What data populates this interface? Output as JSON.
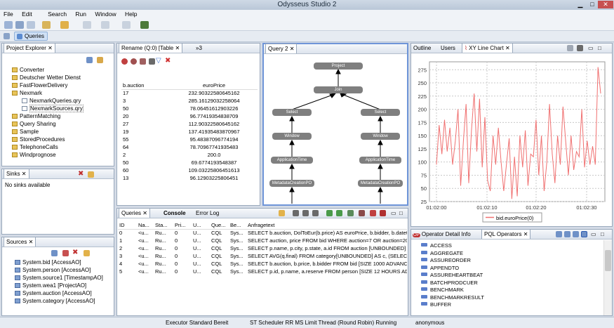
{
  "window": {
    "title": "Odysseus Studio 2"
  },
  "menu": [
    "File",
    "Edit",
    "Search",
    "Run",
    "Window",
    "Help"
  ],
  "perspective": {
    "queries_label": "Queries"
  },
  "project_explorer": {
    "tab": "Project Explorer",
    "items": [
      {
        "label": "Converter",
        "type": "folder",
        "indent": 0
      },
      {
        "label": "Deutscher Wetter Dienst",
        "type": "folder",
        "indent": 0
      },
      {
        "label": "FastFlowerDelivery",
        "type": "folder",
        "indent": 0
      },
      {
        "label": "Nexmark",
        "type": "folder",
        "indent": 0
      },
      {
        "label": "NexmarkQueries.qry",
        "type": "file",
        "indent": 1
      },
      {
        "label": "NexmarkSources.qry",
        "type": "file",
        "indent": 1
      },
      {
        "label": "PatternMatching",
        "type": "folder",
        "indent": 0
      },
      {
        "label": "Query Sharing",
        "type": "folder",
        "indent": 0
      },
      {
        "label": "Sample",
        "type": "folder",
        "indent": 0
      },
      {
        "label": "StoredProcedures",
        "type": "folder",
        "indent": 0
      },
      {
        "label": "TelephoneCalls",
        "type": "folder",
        "indent": 0
      },
      {
        "label": "Windprognose",
        "type": "folder",
        "indent": 0
      }
    ]
  },
  "sinks": {
    "tab": "Sinks",
    "empty": "No sinks available"
  },
  "sources": {
    "tab": "Sources",
    "items": [
      "System.bid [AccessAO]",
      "System.person [AccessAO]",
      "System.source1 [TimestampAO]",
      "System.wea1 [ProjectAO]",
      "System.auction [AccessAO]",
      "System.category [AccessAO]"
    ]
  },
  "rename": {
    "tab": "Rename (Q:0) [Table",
    "overflow": "»3",
    "columns": [
      "b.auction",
      "euroPrice"
    ],
    "rows": [
      [
        "17",
        "232.90322580645162"
      ],
      [
        "3",
        "285.16129032258064"
      ],
      [
        "50",
        "78.06451612903226"
      ],
      [
        "20",
        "96.77419354838709"
      ],
      [
        "27",
        "112.90322580645162"
      ],
      [
        "19",
        "137.41935483870967"
      ],
      [
        "55",
        "95.48387096774194"
      ],
      [
        "64",
        "78.70967741935483"
      ],
      [
        "2",
        "200.0"
      ],
      [
        "50",
        "69.6774193548387"
      ],
      [
        "60",
        "109.03225806451613"
      ],
      [
        "13",
        "96.12903225806451"
      ]
    ]
  },
  "query_graph": {
    "tab": "Query 2",
    "nodes": {
      "project": "Project",
      "join": "Join",
      "select": "Select",
      "window": "Window",
      "apptime": "ApplicationTime",
      "metadata": "MetadataCreationPO"
    }
  },
  "right_tabs": {
    "outline": "Outline",
    "users": "Users",
    "chart": "XY Line Chart"
  },
  "chart_data": {
    "type": "line",
    "title": "",
    "xlabel": "",
    "ylabel": "",
    "x_ticks": [
      "01:02:00",
      "01:02:10",
      "01:02:20",
      "01:02:30"
    ],
    "y_ticks": [
      "25",
      "50",
      "75",
      "100",
      "125",
      "150",
      "175",
      "200",
      "225",
      "250",
      "275"
    ],
    "ylim": [
      25,
      290
    ],
    "legend": "bid.euroPrice(0)",
    "series": [
      {
        "name": "bid.euroPrice(0)",
        "color": "#f07070",
        "values": [
          95,
          170,
          115,
          180,
          120,
          165,
          95,
          140,
          200,
          55,
          140,
          210,
          60,
          160,
          230,
          120,
          220,
          90,
          185,
          65,
          45,
          150,
          95,
          165,
          100,
          45,
          95,
          145,
          30,
          110,
          35,
          150,
          90,
          160,
          55,
          115,
          110,
          180,
          75,
          150,
          45,
          100,
          210,
          115,
          60,
          150,
          95,
          205,
          140,
          75,
          150,
          85,
          120,
          110,
          200,
          90,
          140,
          95,
          130,
          95,
          280,
          230
        ]
      }
    ]
  },
  "queries": {
    "tabs": [
      "Queries",
      "Console",
      "Error Log"
    ],
    "columns": [
      "ID",
      "Na...",
      "Sta...",
      "Pri...",
      "U...",
      "Que...",
      "Be...",
      "Anfragetext"
    ],
    "rows": [
      [
        "0",
        "<u...",
        "Ru...",
        "0",
        "U...",
        "CQL",
        "Sys...",
        "SELECT b.auction, DolToEur(b.price) AS euroPrice, b.bidder, b.datetime ..."
      ],
      [
        "1",
        "<u...",
        "Ru...",
        "0",
        "U...",
        "CQL",
        "Sys...",
        "SELECT auction, price FROM bid WHERE auction=7 OR auction=20 OR a..."
      ],
      [
        "2",
        "<u...",
        "Ru...",
        "0",
        "U...",
        "CQL",
        "Sys...",
        "SELECT p.name, p.city, p.state, a.id FROM auction [UNBOUNDED] AS a, ..."
      ],
      [
        "3",
        "<u...",
        "Ru...",
        "0",
        "U...",
        "CQL",
        "Sys...",
        "SELECT AVG(q.final) FROM category[UNBOUNDED] AS c, (SELECT MAX(..."
      ],
      [
        "4",
        "<u...",
        "Ru...",
        "0",
        "U...",
        "CQL",
        "Sys...",
        "SELECT b.auction, b.price, b.bidder FROM bid [SIZE 1000 ADVANCE 1000..."
      ],
      [
        "5",
        "<u...",
        "Ru...",
        "0",
        "U...",
        "CQL",
        "Sys...",
        "SELECT p.id, p.name, a.reserve FROM person [SIZE 12 HOURS ADVANCE..."
      ]
    ]
  },
  "operators": {
    "tabs": [
      "Operator Detail Info",
      "PQL Operators"
    ],
    "items": [
      "ACCESS",
      "AGGREGATE",
      "ASSUREORDER",
      "APPENDTO",
      "ASSUREHEARTBEAT",
      "BATCHPRODCUER",
      "BENCHMARK",
      "BENCHMARKRESULT",
      "BUFFER"
    ]
  },
  "status": {
    "executor": "Executor Standard Bereit",
    "scheduler": "ST Scheduler RR MS Limit Thread (Round Robin) Running",
    "user": "anonymous"
  }
}
